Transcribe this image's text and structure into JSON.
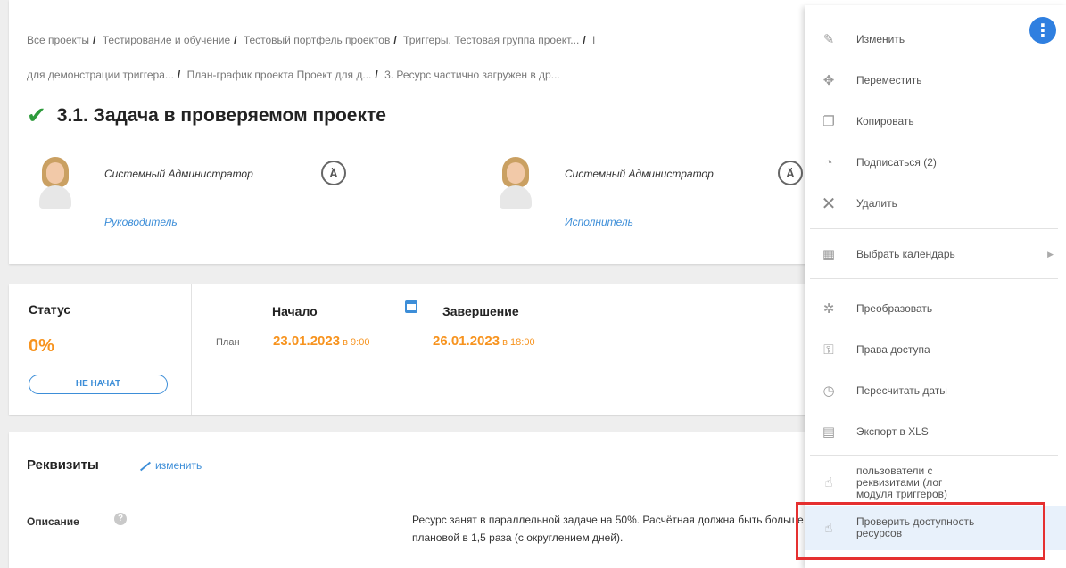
{
  "breadcrumbs": {
    "line1": [
      "Все проекты",
      "Тестирование и обучение",
      "Тестовый портфель проектов",
      "Триггеры. Тестовая группа проект...",
      "I"
    ],
    "line2": [
      "для демонстрации триггера...",
      "План-график проекта Проект для д...",
      "3. Ресурс частично загружен в др..."
    ]
  },
  "task": {
    "title": "3.1. Задача в проверяемом проекте",
    "status_icon": "check-icon",
    "accent_color": "#2e9b3c"
  },
  "people": [
    {
      "name": "Системный Администратор",
      "role": "Руководитель"
    },
    {
      "name": "Системный Администратор",
      "role": "Исполнитель"
    }
  ],
  "status": {
    "label": "Статус",
    "percent": "0%",
    "badge": "НЕ НАЧАТ",
    "accent": "#f7931e"
  },
  "schedule": {
    "start_header": "Начало",
    "end_header": "Завершение",
    "plan_label": "План",
    "start_date": "23.01.2023",
    "start_time": " в 9:00",
    "end_date": "26.01.2023",
    "end_time": " в 18:00"
  },
  "details": {
    "title": "Реквизиты",
    "edit_link": "изменить",
    "desc_label": "Описание",
    "desc_text": "Ресурс занят в параллельной задаче на 50%. Расчётная должна быть больше плановой в 1,5 раза (с округлением дней)."
  },
  "menu": {
    "items": [
      {
        "label": "Изменить",
        "icon": "pencil-icon"
      },
      {
        "label": "Переместить",
        "icon": "move-icon"
      },
      {
        "label": "Копировать",
        "icon": "copy-icon"
      },
      {
        "label": "Подписаться (2)",
        "icon": "rss-icon"
      },
      {
        "label": "Удалить",
        "icon": "close-icon"
      },
      {
        "label": "Выбрать календарь",
        "icon": "calendar-icon"
      },
      {
        "label": "Преобразовать",
        "icon": "wand-icon"
      },
      {
        "label": "Права доступа",
        "icon": "key-icon"
      },
      {
        "label": "Пересчитать даты",
        "icon": "clock-icon"
      },
      {
        "label": "Экспорт в XLS",
        "icon": "table-icon"
      },
      {
        "label": "пользователи с реквизитами (лог модуля триггеров)",
        "icon": "hand-icon"
      },
      {
        "label": "Проверить доступность ресурсов",
        "icon": "hand-icon"
      }
    ],
    "highlight_color": "#e53030"
  }
}
